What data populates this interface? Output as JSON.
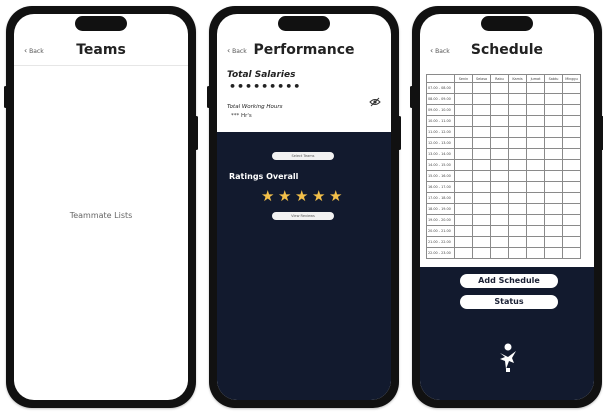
{
  "teams": {
    "back_label": "Back",
    "title": "Teams",
    "placeholder": "Teammate Lists"
  },
  "performance": {
    "back_label": "Back",
    "title": "Performance",
    "total_salaries_label": "Total Salaries",
    "salary_masked": "•••••••••",
    "total_hours_label": "Total Working Hours",
    "hours_masked": "*** Hr's",
    "select_teams_label": "Select Teams",
    "ratings_label": "Ratings Overall",
    "stars": 5,
    "view_reviews_label": "View Reviews",
    "toggle_visibility_icon": "eye-off-icon"
  },
  "schedule": {
    "back_label": "Back",
    "title": "Schedule",
    "days": [
      "Senin",
      "Selasa",
      "Rabu",
      "Kamis",
      "Jumat",
      "Sabtu",
      "Minggu"
    ],
    "times": [
      "07.00 - 08.00",
      "08.00 - 09.00",
      "09.00 - 10.00",
      "10.00 - 11.00",
      "11.00 - 12.00",
      "12.00 - 13.00",
      "13.00 - 14.00",
      "14.00 - 15.00",
      "15.00 - 16.00",
      "16.00 - 17.00",
      "17.00 - 18.00",
      "18.00 - 19.00",
      "19.00 - 20.00",
      "20.00 - 21.00",
      "21.00 - 22.00",
      "22.00 - 23.00"
    ],
    "add_schedule_label": "Add Schedule",
    "status_label": "Status",
    "logo_icon": "runner-logo-icon"
  },
  "colors": {
    "dark_navy": "#121a2e",
    "star_yellow": "#f3c04a",
    "phone_frame": "#111111"
  }
}
